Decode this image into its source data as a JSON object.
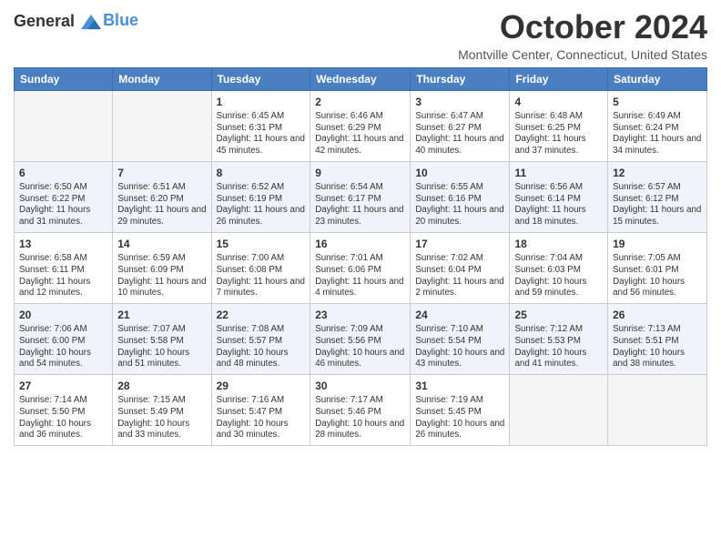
{
  "header": {
    "logo_line1": "General",
    "logo_line2": "Blue",
    "title": "October 2024",
    "location": "Montville Center, Connecticut, United States"
  },
  "days_of_week": [
    "Sunday",
    "Monday",
    "Tuesday",
    "Wednesday",
    "Thursday",
    "Friday",
    "Saturday"
  ],
  "weeks": [
    [
      {
        "day": "",
        "info": ""
      },
      {
        "day": "",
        "info": ""
      },
      {
        "day": "1",
        "info": "Sunrise: 6:45 AM\nSunset: 6:31 PM\nDaylight: 11 hours and 45 minutes."
      },
      {
        "day": "2",
        "info": "Sunrise: 6:46 AM\nSunset: 6:29 PM\nDaylight: 11 hours and 42 minutes."
      },
      {
        "day": "3",
        "info": "Sunrise: 6:47 AM\nSunset: 6:27 PM\nDaylight: 11 hours and 40 minutes."
      },
      {
        "day": "4",
        "info": "Sunrise: 6:48 AM\nSunset: 6:25 PM\nDaylight: 11 hours and 37 minutes."
      },
      {
        "day": "5",
        "info": "Sunrise: 6:49 AM\nSunset: 6:24 PM\nDaylight: 11 hours and 34 minutes."
      }
    ],
    [
      {
        "day": "6",
        "info": "Sunrise: 6:50 AM\nSunset: 6:22 PM\nDaylight: 11 hours and 31 minutes."
      },
      {
        "day": "7",
        "info": "Sunrise: 6:51 AM\nSunset: 6:20 PM\nDaylight: 11 hours and 29 minutes."
      },
      {
        "day": "8",
        "info": "Sunrise: 6:52 AM\nSunset: 6:19 PM\nDaylight: 11 hours and 26 minutes."
      },
      {
        "day": "9",
        "info": "Sunrise: 6:54 AM\nSunset: 6:17 PM\nDaylight: 11 hours and 23 minutes."
      },
      {
        "day": "10",
        "info": "Sunrise: 6:55 AM\nSunset: 6:16 PM\nDaylight: 11 hours and 20 minutes."
      },
      {
        "day": "11",
        "info": "Sunrise: 6:56 AM\nSunset: 6:14 PM\nDaylight: 11 hours and 18 minutes."
      },
      {
        "day": "12",
        "info": "Sunrise: 6:57 AM\nSunset: 6:12 PM\nDaylight: 11 hours and 15 minutes."
      }
    ],
    [
      {
        "day": "13",
        "info": "Sunrise: 6:58 AM\nSunset: 6:11 PM\nDaylight: 11 hours and 12 minutes."
      },
      {
        "day": "14",
        "info": "Sunrise: 6:59 AM\nSunset: 6:09 PM\nDaylight: 11 hours and 10 minutes."
      },
      {
        "day": "15",
        "info": "Sunrise: 7:00 AM\nSunset: 6:08 PM\nDaylight: 11 hours and 7 minutes."
      },
      {
        "day": "16",
        "info": "Sunrise: 7:01 AM\nSunset: 6:06 PM\nDaylight: 11 hours and 4 minutes."
      },
      {
        "day": "17",
        "info": "Sunrise: 7:02 AM\nSunset: 6:04 PM\nDaylight: 11 hours and 2 minutes."
      },
      {
        "day": "18",
        "info": "Sunrise: 7:04 AM\nSunset: 6:03 PM\nDaylight: 10 hours and 59 minutes."
      },
      {
        "day": "19",
        "info": "Sunrise: 7:05 AM\nSunset: 6:01 PM\nDaylight: 10 hours and 56 minutes."
      }
    ],
    [
      {
        "day": "20",
        "info": "Sunrise: 7:06 AM\nSunset: 6:00 PM\nDaylight: 10 hours and 54 minutes."
      },
      {
        "day": "21",
        "info": "Sunrise: 7:07 AM\nSunset: 5:58 PM\nDaylight: 10 hours and 51 minutes."
      },
      {
        "day": "22",
        "info": "Sunrise: 7:08 AM\nSunset: 5:57 PM\nDaylight: 10 hours and 48 minutes."
      },
      {
        "day": "23",
        "info": "Sunrise: 7:09 AM\nSunset: 5:56 PM\nDaylight: 10 hours and 46 minutes."
      },
      {
        "day": "24",
        "info": "Sunrise: 7:10 AM\nSunset: 5:54 PM\nDaylight: 10 hours and 43 minutes."
      },
      {
        "day": "25",
        "info": "Sunrise: 7:12 AM\nSunset: 5:53 PM\nDaylight: 10 hours and 41 minutes."
      },
      {
        "day": "26",
        "info": "Sunrise: 7:13 AM\nSunset: 5:51 PM\nDaylight: 10 hours and 38 minutes."
      }
    ],
    [
      {
        "day": "27",
        "info": "Sunrise: 7:14 AM\nSunset: 5:50 PM\nDaylight: 10 hours and 36 minutes."
      },
      {
        "day": "28",
        "info": "Sunrise: 7:15 AM\nSunset: 5:49 PM\nDaylight: 10 hours and 33 minutes."
      },
      {
        "day": "29",
        "info": "Sunrise: 7:16 AM\nSunset: 5:47 PM\nDaylight: 10 hours and 30 minutes."
      },
      {
        "day": "30",
        "info": "Sunrise: 7:17 AM\nSunset: 5:46 PM\nDaylight: 10 hours and 28 minutes."
      },
      {
        "day": "31",
        "info": "Sunrise: 7:19 AM\nSunset: 5:45 PM\nDaylight: 10 hours and 26 minutes."
      },
      {
        "day": "",
        "info": ""
      },
      {
        "day": "",
        "info": ""
      }
    ]
  ]
}
